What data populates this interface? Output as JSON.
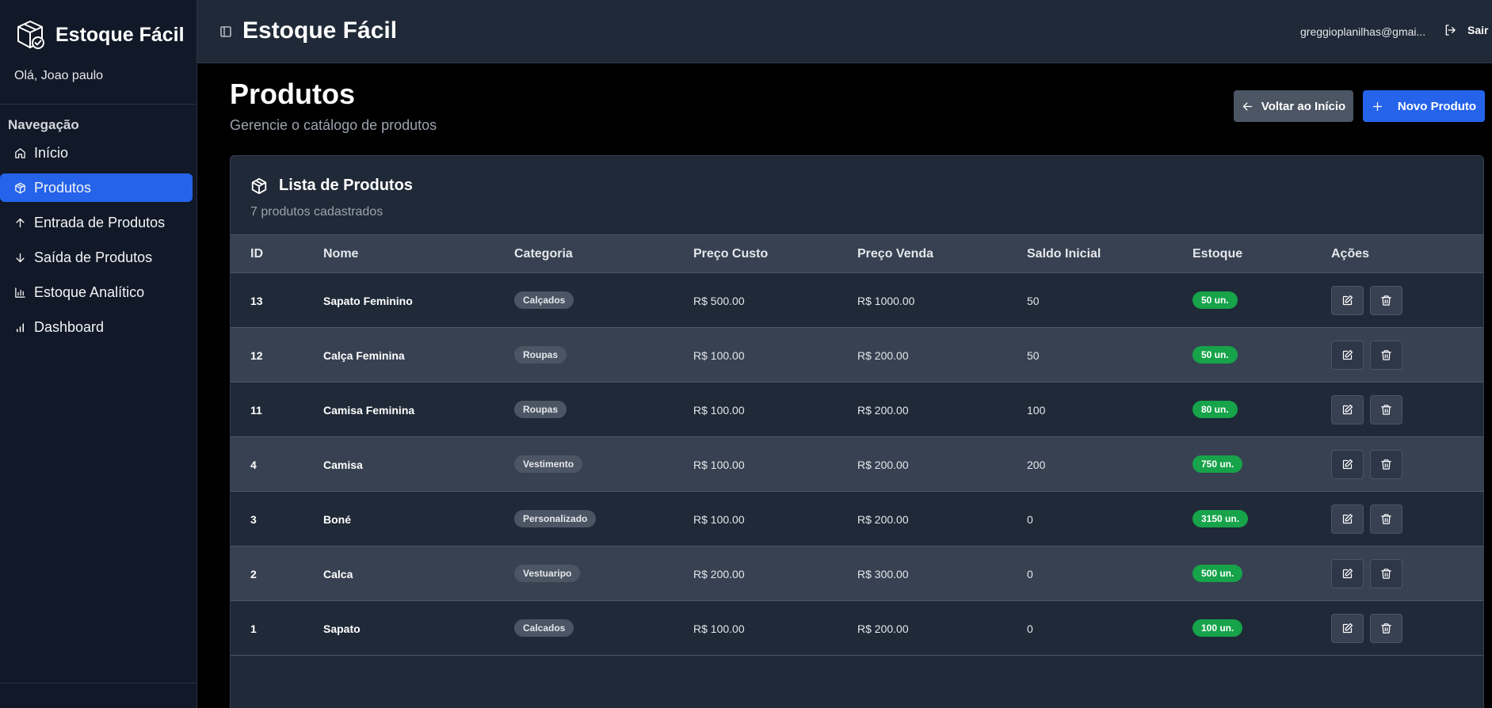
{
  "app": {
    "brand_name": "Estoque Fácil",
    "greeting": "Olá, Joao paulo",
    "top_title": "Estoque Fácil",
    "user_email": "greggioplanilhas@gmai...",
    "logout_label": "Sair"
  },
  "sidebar": {
    "nav_title": "Navegação",
    "items": [
      {
        "label": "Início",
        "icon": "home-icon",
        "active": false
      },
      {
        "label": "Produtos",
        "icon": "package-icon",
        "active": true
      },
      {
        "label": "Entrada de Produtos",
        "icon": "arrow-up-icon",
        "active": false
      },
      {
        "label": "Saída de Produtos",
        "icon": "arrow-down-icon",
        "active": false
      },
      {
        "label": "Estoque Analítico",
        "icon": "bar-chart-icon",
        "active": false
      },
      {
        "label": "Dashboard",
        "icon": "signal-bars-icon",
        "active": false
      }
    ]
  },
  "page": {
    "title": "Produtos",
    "subtitle": "Gerencie o catálogo de produtos",
    "back_button": "Voltar ao Início",
    "new_button": "Novo Produto"
  },
  "card": {
    "title": "Lista de Produtos",
    "count": "7 produtos cadastrados"
  },
  "table": {
    "headers": [
      "ID",
      "Nome",
      "Categoria",
      "Preço Custo",
      "Preço Venda",
      "Saldo Inicial",
      "Estoque",
      "Ações"
    ],
    "rows": [
      {
        "id": "13",
        "nome": "Sapato Feminino",
        "categoria": "Calçados",
        "custo": "R$ 500.00",
        "venda": "R$ 1000.00",
        "saldo": "50",
        "estoque": "50 un."
      },
      {
        "id": "12",
        "nome": "Calça Feminina",
        "categoria": "Roupas",
        "custo": "R$ 100.00",
        "venda": "R$ 200.00",
        "saldo": "50",
        "estoque": "50 un."
      },
      {
        "id": "11",
        "nome": "Camisa Feminina",
        "categoria": "Roupas",
        "custo": "R$ 100.00",
        "venda": "R$ 200.00",
        "saldo": "100",
        "estoque": "80 un."
      },
      {
        "id": "4",
        "nome": "Camisa",
        "categoria": "Vestimento",
        "custo": "R$ 100.00",
        "venda": "R$ 200.00",
        "saldo": "200",
        "estoque": "750 un."
      },
      {
        "id": "3",
        "nome": "Boné",
        "categoria": "Personalizado",
        "custo": "R$ 100.00",
        "venda": "R$ 200.00",
        "saldo": "0",
        "estoque": "3150 un."
      },
      {
        "id": "2",
        "nome": "Calca",
        "categoria": "Vestuaripo",
        "custo": "R$ 200.00",
        "venda": "R$ 300.00",
        "saldo": "0",
        "estoque": "500 un."
      },
      {
        "id": "1",
        "nome": "Sapato",
        "categoria": "Calcados",
        "custo": "R$ 100.00",
        "venda": "R$ 200.00",
        "saldo": "0",
        "estoque": "100 un."
      }
    ]
  },
  "colors": {
    "accent": "#2563eb",
    "stock_badge": "#16a34a",
    "sidebar_bg": "#111827",
    "header_bg": "#1f2937"
  }
}
